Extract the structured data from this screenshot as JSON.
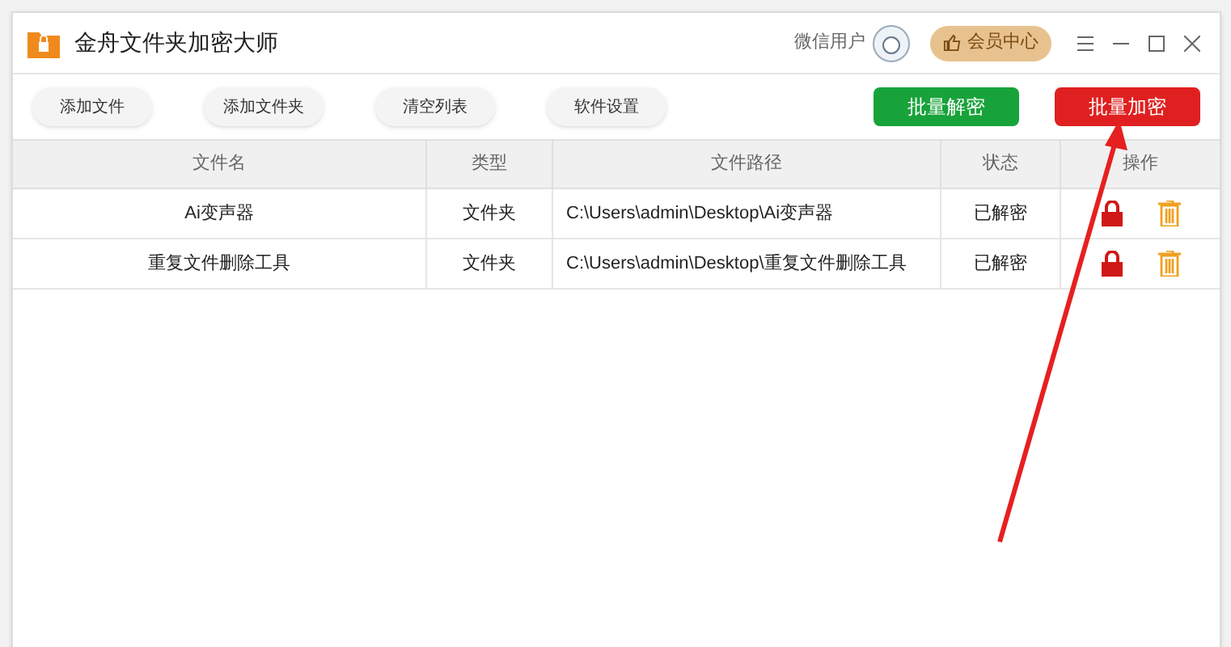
{
  "window": {
    "title": "金舟文件夹加密大师"
  },
  "user": {
    "name": "微信用户"
  },
  "vip_button": {
    "label": "会员中心"
  },
  "toolbar": {
    "buttons": [
      "添加文件",
      "添加文件夹",
      "清空列表",
      "软件设置"
    ],
    "actions": [
      {
        "label": "批量解密",
        "kind": "decrypt"
      },
      {
        "label": "批量加密",
        "kind": "encrypt"
      }
    ]
  },
  "table": {
    "columns": [
      "文件名",
      "类型",
      "文件路径",
      "状态",
      "操作"
    ],
    "rows": [
      {
        "name": "Ai变声器",
        "type": "文件夹",
        "path": "C:\\Users\\admin\\Desktop\\Ai变声器",
        "status": "已解密"
      },
      {
        "name": "重复文件删除工具",
        "type": "文件夹",
        "path": "C:\\Users\\admin\\Desktop\\重复文件删除工具",
        "status": "已解密"
      }
    ]
  }
}
